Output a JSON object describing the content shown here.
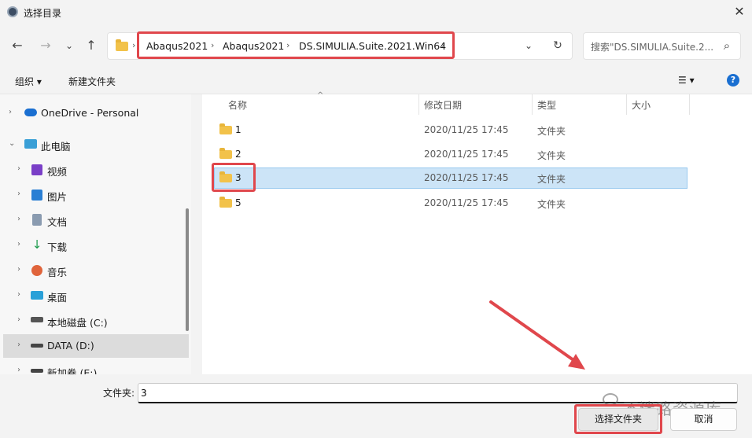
{
  "window": {
    "title": "选择目录",
    "close_label": "✕"
  },
  "nav": {
    "back": "←",
    "forward": "→",
    "recent": "⌄",
    "up": "↑",
    "breadcrumbs": [
      "Abaqus2021",
      "Abaqus2021",
      "DS.SIMULIA.Suite.2021.Win64"
    ],
    "crumb_sep": "›",
    "dropdown": "⌄",
    "refresh": "↻",
    "search_placeholder": "搜索\"DS.SIMULIA.Suite.2...",
    "search_icon": "⌕"
  },
  "toolbar": {
    "organize": "组织 ▾",
    "new_folder": "新建文件夹",
    "view_icon": "☰ ▾",
    "help": "?"
  },
  "sidebar": {
    "items": [
      {
        "label": "OneDrive - Personal",
        "icon": "cloud-icon",
        "color": "#1a6fd1"
      },
      {
        "label": "此电脑",
        "icon": "computer-icon",
        "color": "#3a9fd6"
      },
      {
        "label": "视频",
        "icon": "video-icon",
        "color": "#7a3fc7"
      },
      {
        "label": "图片",
        "icon": "picture-icon",
        "color": "#2a7fd4"
      },
      {
        "label": "文档",
        "icon": "document-icon",
        "color": "#8a9bb0"
      },
      {
        "label": "下载",
        "icon": "download-icon",
        "color": "#1b9a4b"
      },
      {
        "label": "音乐",
        "icon": "music-icon",
        "color": "#e0643b"
      },
      {
        "label": "桌面",
        "icon": "desktop-icon",
        "color": "#2aa0d8"
      },
      {
        "label": "本地磁盘 (C:)",
        "icon": "drive-icon",
        "color": "#555555"
      },
      {
        "label": "DATA (D:)",
        "icon": "drive-icon",
        "color": "#444444"
      },
      {
        "label": "新加卷 (E:)",
        "icon": "drive-icon",
        "color": "#444444"
      }
    ]
  },
  "columns": {
    "name": "名称",
    "date": "修改日期",
    "type": "类型",
    "size": "大小",
    "sort_indicator": "^"
  },
  "files": [
    {
      "name": "1",
      "date": "2020/11/25 17:45",
      "type": "文件夹"
    },
    {
      "name": "2",
      "date": "2020/11/25 17:45",
      "type": "文件夹"
    },
    {
      "name": "3",
      "date": "2020/11/25 17:45",
      "type": "文件夹"
    },
    {
      "name": "5",
      "date": "2020/11/25 17:45",
      "type": "文件夹"
    }
  ],
  "footer": {
    "folder_label": "文件夹:",
    "folder_value": "3",
    "select_button": "选择文件夹",
    "cancel_button": "取消",
    "watermark": "不迷路资源库"
  },
  "colors": {
    "annotation_red": "#e0474c",
    "selection_bg": "#cce4f7",
    "folder_yellow": "#f2c24a"
  }
}
